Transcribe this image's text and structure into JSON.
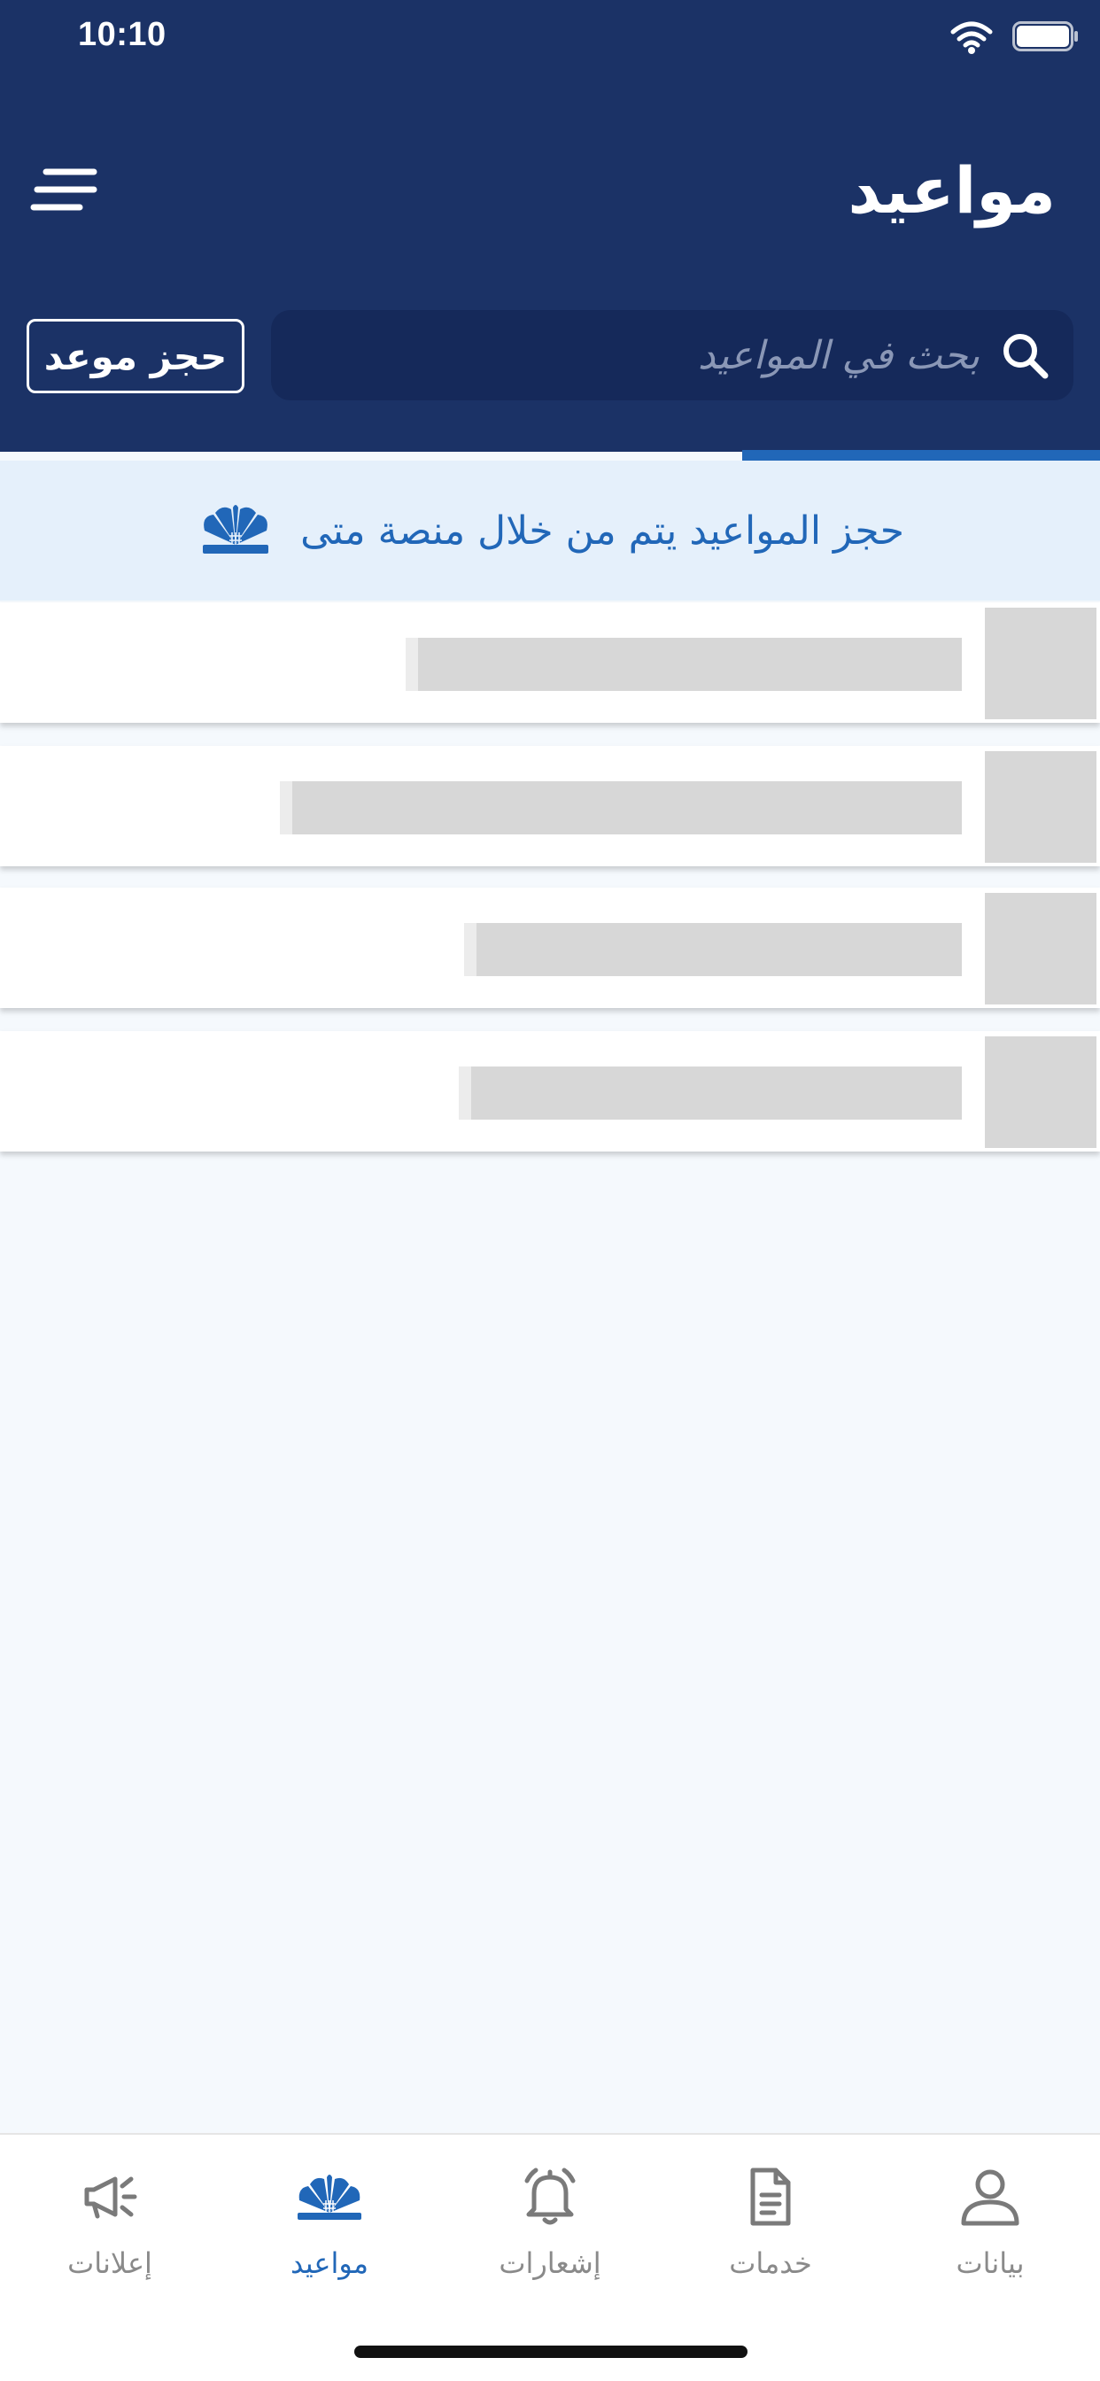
{
  "status_bar": {
    "time": "10:10"
  },
  "header": {
    "title": "مواعيد",
    "book_button_label": "حجز موعد",
    "search_placeholder": "بحث في المواعيد"
  },
  "info_banner": {
    "text": "حجز المواعيد يتم من خلال منصة متى"
  },
  "skeleton_rows": 4,
  "bottom_nav": {
    "items": [
      {
        "label": "إعلانات",
        "icon": "megaphone-icon"
      },
      {
        "label": "مواعيد",
        "icon": "kuwait-emblem-icon",
        "active": true
      },
      {
        "label": "إشعارات",
        "icon": "bell-icon"
      },
      {
        "label": "خدمات",
        "icon": "document-icon"
      },
      {
        "label": "بيانات",
        "icon": "user-icon"
      }
    ]
  },
  "colors": {
    "header_bg": "#1b3266",
    "search_bg": "#15295a",
    "accent": "#2167b8",
    "banner_bg": "#e5f0fb",
    "page_bg": "#f5f9fd",
    "skeleton": "#d7d7d7",
    "inactive_nav": "#8a8a8a"
  }
}
